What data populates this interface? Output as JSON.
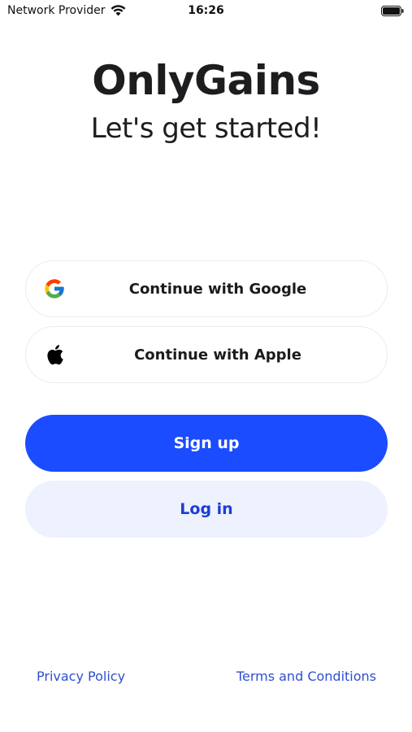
{
  "status_bar": {
    "carrier": "Network Provider",
    "time": "16:26"
  },
  "header": {
    "title": "OnlyGains",
    "subtitle": "Let's get started!"
  },
  "auth": {
    "google_label": "Continue with Google",
    "apple_label": "Continue with Apple",
    "signup_label": "Sign up",
    "login_label": "Log in"
  },
  "footer": {
    "privacy_label": "Privacy Policy",
    "terms_label": "Terms and Conditions"
  },
  "colors": {
    "primary": "#1b4cff",
    "secondary_bg": "#eef1fe",
    "link": "#2f4fd0"
  },
  "icons": {
    "google": "google-logo-icon",
    "apple": "apple-logo-icon",
    "wifi": "wifi-icon",
    "battery": "battery-icon"
  }
}
